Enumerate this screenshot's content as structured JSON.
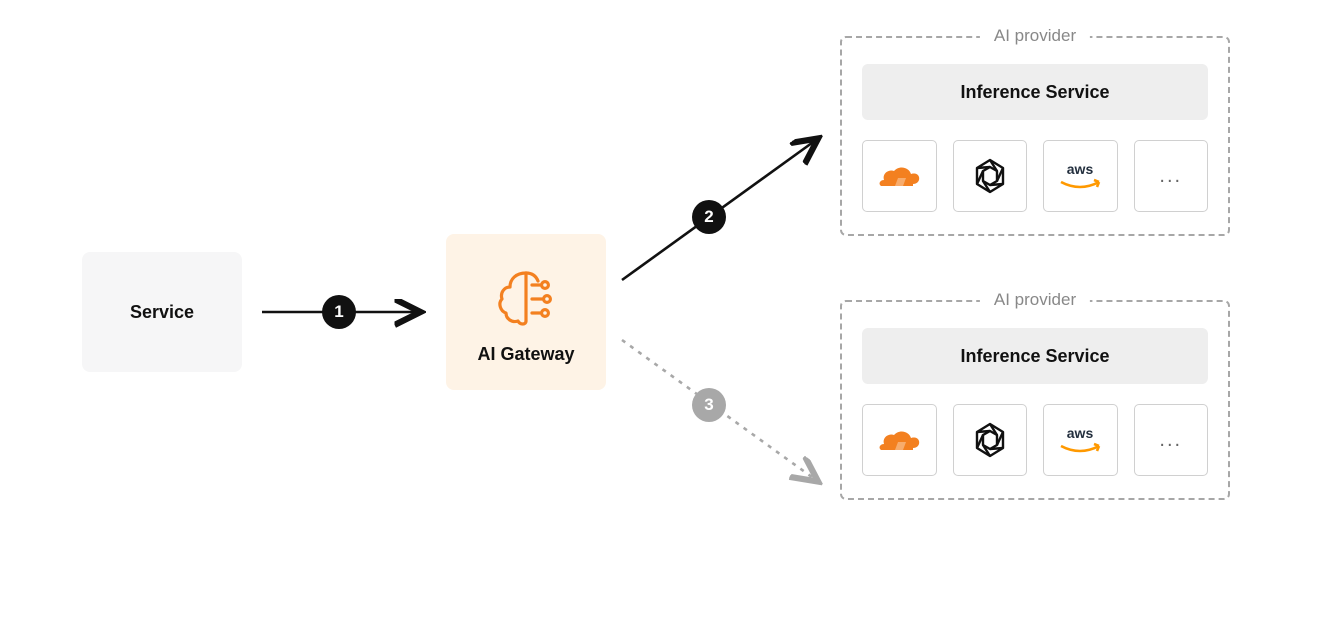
{
  "service": {
    "label": "Service"
  },
  "gateway": {
    "label": "AI Gateway"
  },
  "providers": {
    "caption": "AI provider",
    "inference_label": "Inference Service",
    "icons": [
      "cloudflare",
      "openai",
      "aws",
      "more"
    ],
    "more_label": "..."
  },
  "steps": {
    "one": "1",
    "two": "2",
    "three": "3"
  }
}
